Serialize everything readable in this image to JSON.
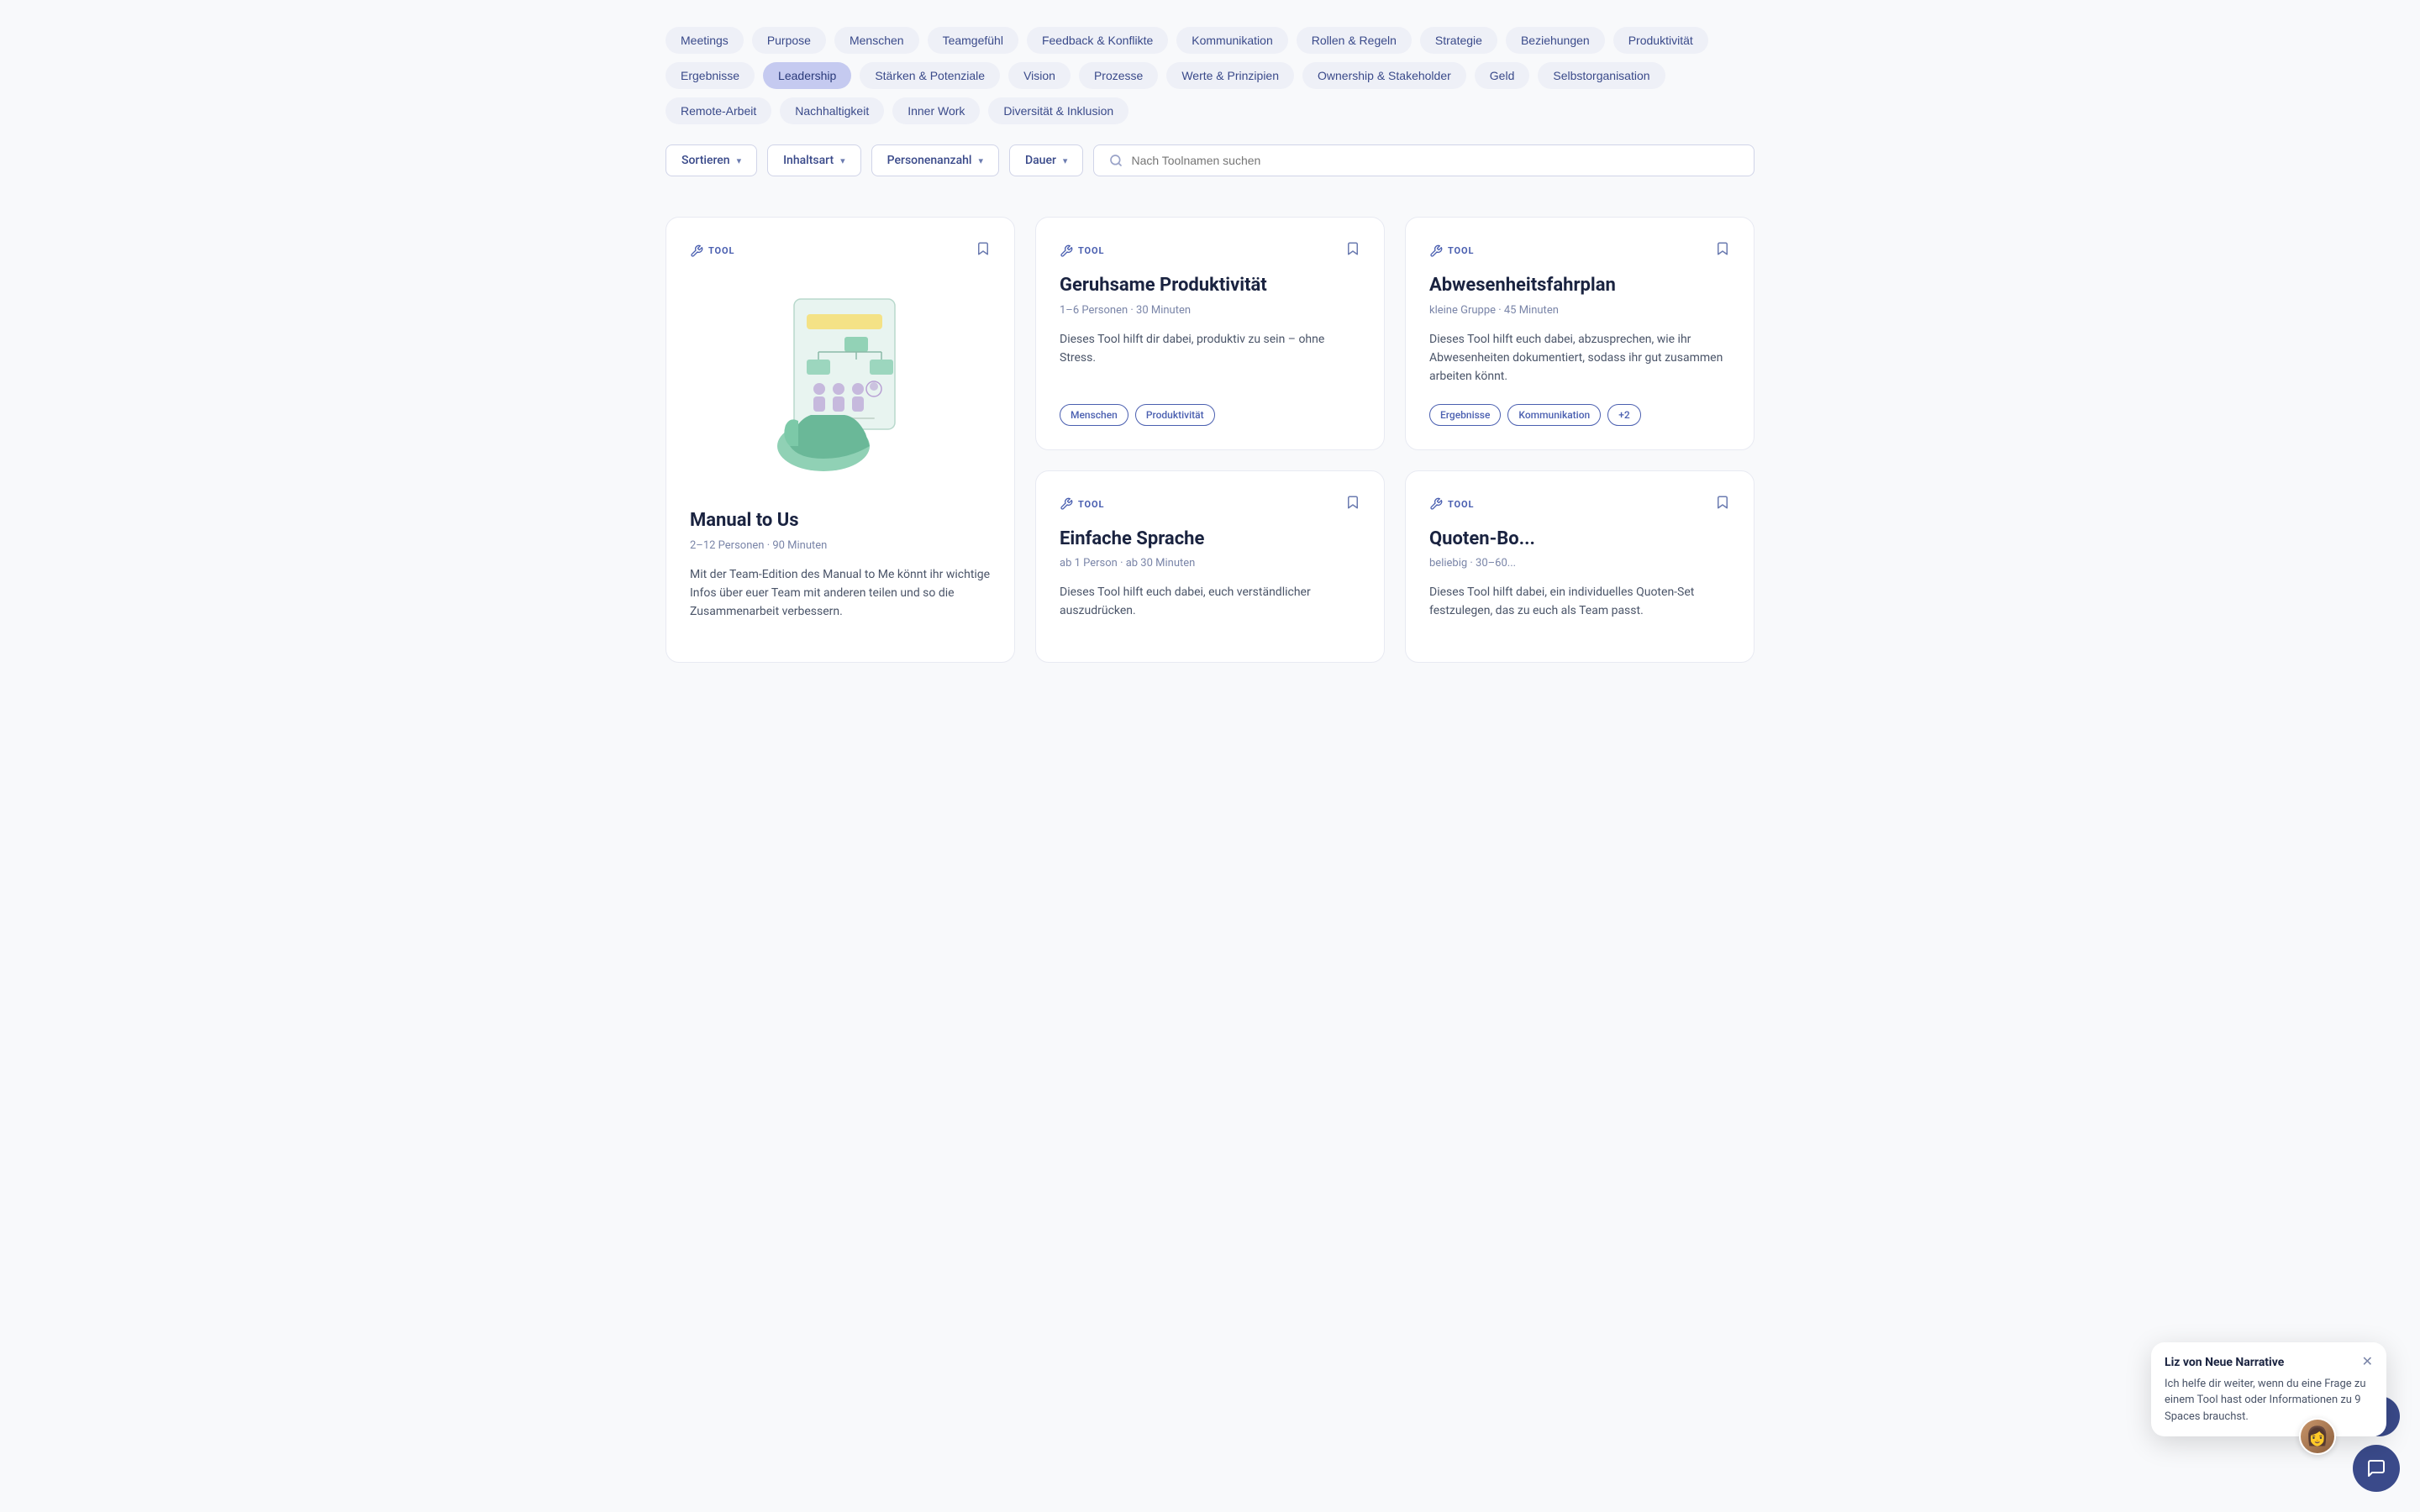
{
  "tags": [
    {
      "id": "meetings",
      "label": "Meetings",
      "active": false
    },
    {
      "id": "purpose",
      "label": "Purpose",
      "active": false
    },
    {
      "id": "menschen",
      "label": "Menschen",
      "active": false
    },
    {
      "id": "teamgefuehl",
      "label": "Teamgefühl",
      "active": false
    },
    {
      "id": "feedback-konflikte",
      "label": "Feedback & Konflikte",
      "active": false
    },
    {
      "id": "kommunikation",
      "label": "Kommunikation",
      "active": false
    },
    {
      "id": "rollen-regeln",
      "label": "Rollen & Regeln",
      "active": false
    },
    {
      "id": "strategie",
      "label": "Strategie",
      "active": false
    },
    {
      "id": "beziehungen",
      "label": "Beziehungen",
      "active": false
    },
    {
      "id": "produktivitaet",
      "label": "Produktivität",
      "active": false
    },
    {
      "id": "ergebnisse",
      "label": "Ergebnisse",
      "active": false
    },
    {
      "id": "leadership",
      "label": "Leadership",
      "active": true
    },
    {
      "id": "staerken-potenziale",
      "label": "Stärken & Potenziale",
      "active": false
    },
    {
      "id": "vision",
      "label": "Vision",
      "active": false
    },
    {
      "id": "prozesse",
      "label": "Prozesse",
      "active": false
    },
    {
      "id": "werte-prinzipien",
      "label": "Werte & Prinzipien",
      "active": false
    },
    {
      "id": "ownership-stakeholder",
      "label": "Ownership & Stakeholder",
      "active": false
    },
    {
      "id": "geld",
      "label": "Geld",
      "active": false
    },
    {
      "id": "selbstorganisation",
      "label": "Selbstorganisation",
      "active": false
    },
    {
      "id": "remote-arbeit",
      "label": "Remote-Arbeit",
      "active": false
    },
    {
      "id": "nachhaltigkeit",
      "label": "Nachhaltigkeit",
      "active": false
    },
    {
      "id": "inner-work",
      "label": "Inner Work",
      "active": false
    },
    {
      "id": "diversitaet-inklusion",
      "label": "Diversität & Inklusion",
      "active": false
    }
  ],
  "filters": {
    "sortieren": "Sortieren",
    "inhaltsart": "Inhaltsart",
    "personenanzahl": "Personenanzahl",
    "dauer": "Dauer",
    "search_placeholder": "Nach Toolnamen suchen"
  },
  "cards": [
    {
      "id": "manual-to-us",
      "type": "TOOL",
      "title": "Manual to Us",
      "meta": "2–12 Personen · 90 Minuten",
      "description": "Mit der Team-Edition des Manual to Me könnt ihr wichtige Infos über euer Team mit anderen teilen und so die Zusammenarbeit verbessern.",
      "tags": [],
      "has_illustration": true,
      "large": true
    },
    {
      "id": "geruhsame-produktivitaet",
      "type": "TOOL",
      "title": "Geruhsame Produktivität",
      "meta": "1–6 Personen · 30 Minuten",
      "description": "Dieses Tool hilft dir dabei, produktiv zu sein – ohne Stress.",
      "tags": [
        "Menschen",
        "Produktivität"
      ],
      "has_illustration": false,
      "large": false
    },
    {
      "id": "abwesenheitsfahrplan",
      "type": "TOOL",
      "title": "Abwesenheitsfahrplan",
      "meta": "kleine Gruppe · 45 Minuten",
      "description": "Dieses Tool hilft euch dabei, abzusprechen, wie ihr Abwesenheiten dokumentiert, sodass ihr gut zusammen arbeiten könnt.",
      "tags": [
        "Ergebnisse",
        "Kommunikation"
      ],
      "tags_more": "+2",
      "has_illustration": false,
      "large": false
    },
    {
      "id": "einfache-sprache",
      "type": "TOOL",
      "title": "Einfache Sprache",
      "meta": "ab 1 Person · ab 30 Minuten",
      "description": "Dieses Tool hilft euch dabei, euch verständlicher auszudrücken.",
      "tags": [],
      "has_illustration": false,
      "large": false
    },
    {
      "id": "quoten-boka",
      "type": "TOOL",
      "title": "Quoten-Bo...",
      "meta": "beliebig · 30–60...",
      "description": "Dieses Tool hilft dabei, ein individuelles Quoten-Set festzulegen, das zu euch als Team passt.",
      "tags": [],
      "has_illustration": false,
      "large": false
    }
  ],
  "chat": {
    "name": "Liz von Neue Narrative",
    "message": "Ich helfe dir weiter, wenn du eine Frage zu einem Tool hast oder Informationen zu 9 Spaces brauchst."
  }
}
